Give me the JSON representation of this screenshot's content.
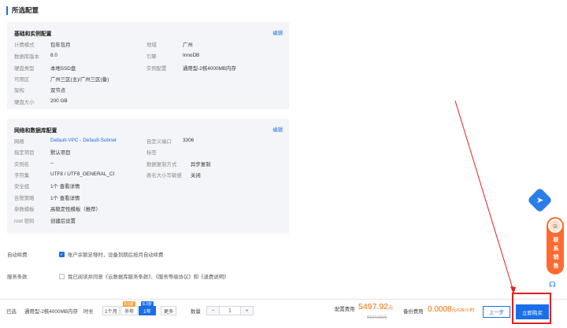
{
  "section_title": "所选配置",
  "basic": {
    "heading": "基础和实例配置",
    "edit": "编辑",
    "left": [
      {
        "label": "计费模式",
        "value": "包年包月"
      },
      {
        "label": "数据库版本",
        "value": "8.0"
      },
      {
        "label": "硬盘类型",
        "value": "本地SSD盘"
      },
      {
        "label": "可用区",
        "value": "广州三区(主)/广州三区(备)"
      },
      {
        "label": "架构",
        "value": "双节点"
      },
      {
        "label": "硬盘大小",
        "value": "200 GB"
      }
    ],
    "right": [
      {
        "label": "地域",
        "value": "广州"
      },
      {
        "label": "引擎",
        "value": "InnoDB"
      },
      {
        "label": "实例配置",
        "value": "通用型-2核4000MB内存"
      }
    ]
  },
  "network": {
    "heading": "网络和数据库配置",
    "edit": "编辑",
    "left": [
      {
        "label": "网络",
        "value": "Default-VPC - Default-Subnet"
      },
      {
        "label": "指定项目",
        "value": "默认项目"
      },
      {
        "label": "实例名",
        "value": "--"
      },
      {
        "label": "字符集",
        "value": "UTF8 / UTF8_GENERAL_CI"
      },
      {
        "label": "安全组",
        "value": "1个 查看详情"
      },
      {
        "label": "告警策略",
        "value": "1个 查看详情"
      },
      {
        "label": "参数模板",
        "value": "高稳定性模板（推荐）"
      },
      {
        "label": "root 密码",
        "value": "创建后设置"
      }
    ],
    "right": [
      {
        "label": "自定义端口",
        "value": "3306"
      },
      {
        "label": "标签",
        "value": ""
      },
      {
        "label": "数据复制方式",
        "value": "异步复制"
      },
      {
        "label": "表名大小写敏感",
        "value": "关闭"
      }
    ]
  },
  "auto_renew": {
    "label": "自动续费",
    "text": "账户余额足够时，设备到期后按月自动续费",
    "checked": true
  },
  "terms": {
    "label": "服务条款",
    "text": "我已阅读并同意《云数据库服务条款》、《服务等级协议》和《退费说明》",
    "checked": false
  },
  "footer": {
    "selected_label": "已选",
    "selected_value": "通用型-2核4000MB内存",
    "duration_label": "时长",
    "durations": [
      {
        "label": "1个月",
        "badge": ""
      },
      {
        "label": "半年",
        "badge": "8.5折"
      },
      {
        "label": "1年",
        "badge": "8.3折"
      },
      {
        "label": "更多",
        "badge": ""
      }
    ],
    "selected_duration": "1年",
    "qty_label": "数量",
    "minus": "−",
    "qty": "1",
    "plus": "+",
    "price_label": "配置费用",
    "price": "5497.92",
    "price_unit": "元",
    "price_old": "6624.00元",
    "backup_label": "备份费用",
    "backup_price": "0.0008",
    "backup_unit": "元/GB/小时",
    "prev_button": "上一步",
    "buy_button": "立即购买"
  },
  "float": {
    "contact_text": "联系销售"
  },
  "colors": {
    "accent": "#1a6fe8",
    "price": "#ff6a00",
    "highlight": "#e02020"
  }
}
